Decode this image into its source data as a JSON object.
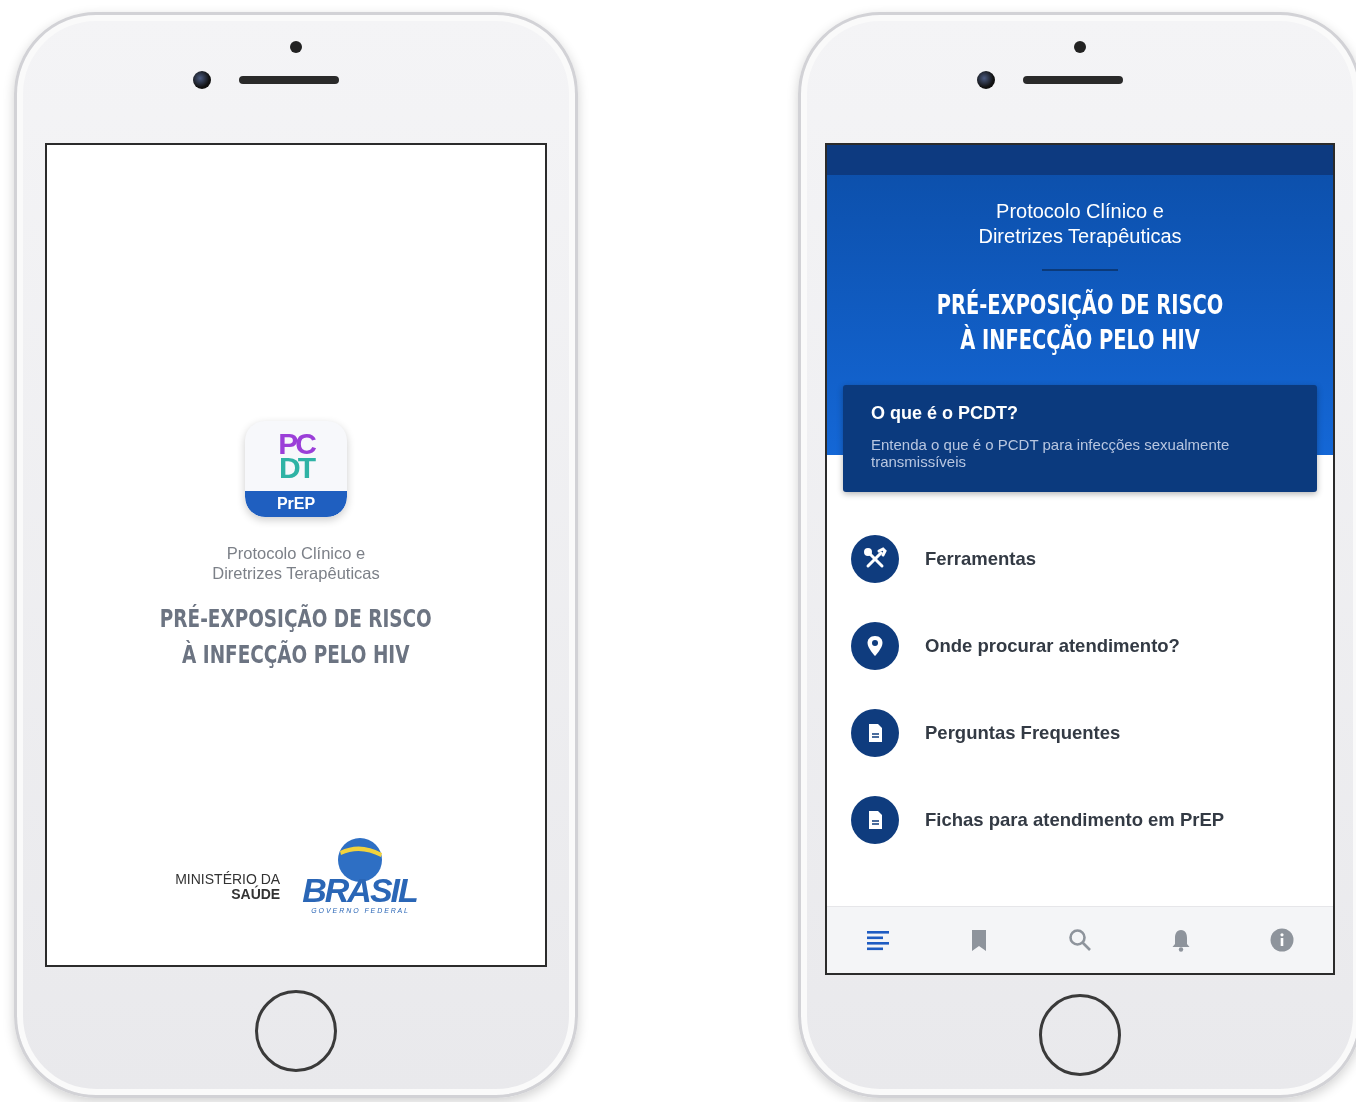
{
  "splash": {
    "app_icon": {
      "letters_top": "PC",
      "letters_bottom": "DT",
      "band": "PrEP"
    },
    "subtitle_lines": [
      "Protocolo Clínico e",
      "Diretrizes Terapêuticas"
    ],
    "title_lines": [
      "PRÉ-EXPOSIÇÃO DE RISCO",
      "À INFECÇÃO PELO HIV"
    ],
    "ministry": {
      "line1": "MINISTÉRIO DA",
      "line2": "SAÚDE"
    },
    "government_logo": {
      "word": "BRASIL",
      "tagline": "G O V E R N O   F E D E R A L"
    }
  },
  "home": {
    "subtitle_lines": [
      "Protocolo Clínico e",
      "Diretrizes Terapêuticas"
    ],
    "title_lines": [
      "PRÉ-EXPOSIÇÃO DE RISCO",
      "À INFECÇÃO PELO HIV"
    ],
    "intro_card": {
      "title": "O que é o PCDT?",
      "description": "Entenda o que é o PCDT para infecções sexualmente transmissíveis"
    },
    "menu": [
      {
        "kind": "tools",
        "label": "Ferramentas"
      },
      {
        "kind": "location",
        "label": "Onde procurar atendimento?"
      },
      {
        "kind": "document",
        "label": "Perguntas Frequentes"
      },
      {
        "kind": "document",
        "label": "Fichas para atendimento em PrEP"
      }
    ],
    "bottom_nav": [
      {
        "kind": "list",
        "selected": true
      },
      {
        "kind": "bookmark",
        "selected": false
      },
      {
        "kind": "search",
        "selected": false
      },
      {
        "kind": "bell",
        "selected": false
      },
      {
        "kind": "info",
        "selected": false
      }
    ]
  }
}
